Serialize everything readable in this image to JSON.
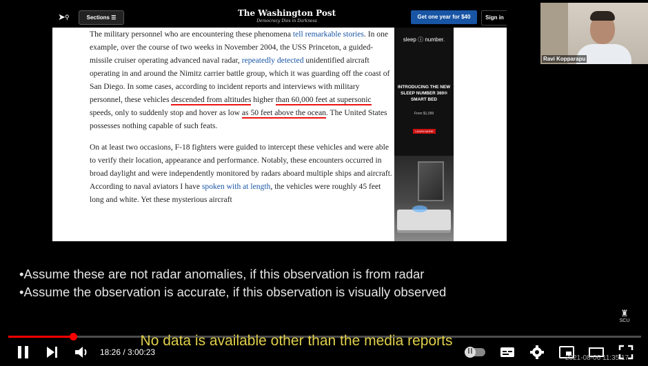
{
  "video": {
    "time_current": "18:26",
    "time_total": "3:00:23",
    "time_display": "18:26 / 3:00:23",
    "progress_fraction": 0.1021,
    "caption": "No data is available other than the media reports",
    "burned_in_timestamp": "2021-08-06  11:35:17"
  },
  "slide": {
    "bullets": [
      "•Assume these are not radar anomalies, if this observation is from radar",
      "•Assume the observation is accurate, if this observation is visually observed"
    ],
    "logo_text": "SCU"
  },
  "presenter": {
    "name": "Ravi Kopparapu"
  },
  "wapo": {
    "sections_label": "Sections",
    "logo": "The Washington Post",
    "tagline": "Democracy Dies in Darkness",
    "cta": "Get one year for $40",
    "sign_in": "Sign in",
    "p1": {
      "t1": "The military personnel who are encountering these phenomena ",
      "link1": "tell remarkable stories",
      "t2": ". In one example, over the course of two weeks in November 2004, the USS Princeton, a guided-missile cruiser operating advanced naval radar, ",
      "link2": "repeatedly detected",
      "t3": " unidentified aircraft operating in and around the Nimitz carrier battle group, which it was guarding off the coast of San Diego. In some cases, according to incident reports and interviews with military personnel, these vehicles ",
      "hl1": "descended from altitudes",
      "t4": " higher ",
      "hl2": "than 60,000 feet at supersonic",
      "t5": " speeds, only to suddenly stop and hover as low ",
      "hl3": "as 50 feet above the ocean",
      "t6": ". The United States possesses nothing capable of such feats."
    },
    "p2": {
      "t1": "On at least two occasions, F-18 fighters were guided to intercept these vehicles and were able to verify their location, appearance and performance. Notably, these encounters occurred in broad daylight and were independently monitored by radars aboard multiple ships and aircraft. According to naval aviators I have ",
      "link1": "spoken with at length",
      "t2": ", the vehicles were roughly 45 feet long and white. Yet these mysterious aircraft"
    },
    "ad": {
      "brand": "sleep ⓘ number.",
      "headline": "INTRODUCING THE NEW SLEEP NUMBER 360® SMART BED",
      "price": "From $1,099",
      "button": "LEARN MORE"
    }
  },
  "icons": [
    "cursor-icon",
    "search-icon",
    "menu-icon",
    "pause-icon",
    "next-icon",
    "volume-icon",
    "autoplay-toggle",
    "captions-icon",
    "settings-icon",
    "miniplayer-icon",
    "theater-icon",
    "fullscreen-icon"
  ],
  "colors": {
    "progress": "#ff0000",
    "caption": "#e0d04a",
    "wapo_cta": "#1955a5",
    "highlight_underline": "#ee1111"
  }
}
